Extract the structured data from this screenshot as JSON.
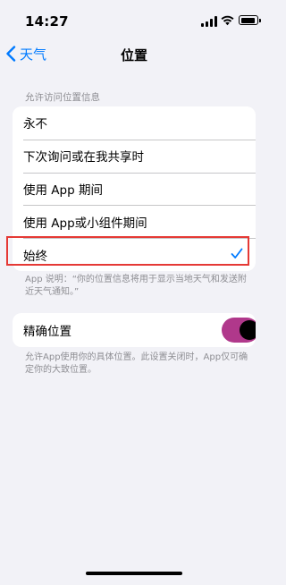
{
  "status_bar": {
    "time": "14:27"
  },
  "nav": {
    "back_label": "天气",
    "title": "位置"
  },
  "access": {
    "header": "允许访问位置信息",
    "options": [
      {
        "label": "永不",
        "selected": false
      },
      {
        "label": "下次询问或在我共享时",
        "selected": false
      },
      {
        "label": "使用 App 期间",
        "selected": false
      },
      {
        "label": "使用 App或小组件期间",
        "selected": false
      },
      {
        "label": "始终",
        "selected": true
      }
    ],
    "footnote": "App 说明：“你的位置信息将用于显示当地天气和发送附近天气通知。”"
  },
  "precise": {
    "label": "精确位置",
    "enabled": true,
    "footnote": "允许App使用你的具体位置。此设置关闭时，App仅可确定你的大致位置。"
  },
  "colors": {
    "accent": "#007aff",
    "toggle_on": "#b0388b",
    "highlight": "#e53935",
    "background": "#f2f2f7"
  },
  "icons": [
    "signal-icon",
    "wifi-icon",
    "battery-icon",
    "chevron-left-icon",
    "checkmark-icon"
  ]
}
